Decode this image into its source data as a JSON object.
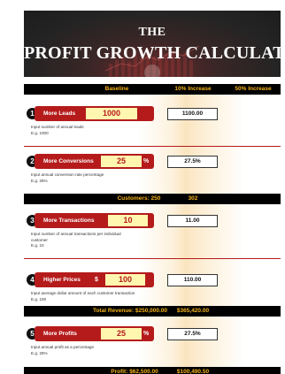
{
  "banner": {
    "title_small": "THE",
    "title_large": "PROFIT GROWTH CALCULATOR"
  },
  "header": {
    "baseline": "Baseline",
    "increase10": "10% Increase",
    "increase50": "50% Increase"
  },
  "steps": [
    {
      "number": "1",
      "label": "More Leads",
      "prefix": "",
      "value": "1000",
      "suffix": "",
      "help": [
        "Input number of annual leads",
        "E.g. 1000"
      ],
      "result": "1100.00"
    },
    {
      "number": "2",
      "label": "More Conversions",
      "prefix": "",
      "value": "25",
      "suffix": "%",
      "help": [
        "Input annual conversion rate percentage",
        "E.g. 25%"
      ],
      "result": "27.5%"
    },
    {
      "number": "3",
      "label": "More Transactions",
      "prefix": "",
      "value": "10",
      "suffix": "",
      "help": [
        "Input number of annual transactions per individual",
        "customer",
        "E.g. 10"
      ],
      "result": "11.00"
    },
    {
      "number": "4",
      "label": "Higher Prices",
      "prefix": "$",
      "value": "100",
      "suffix": "",
      "help": [
        "Input average dollar amount of each customer transaction",
        "E.g. 100"
      ],
      "result": "110.00"
    },
    {
      "number": "5",
      "label": "More Profits",
      "prefix": "",
      "value": "25",
      "suffix": "%",
      "help": [
        "Input annual profit as a percentage",
        "E.g. 25%"
      ],
      "result": "27.5%"
    }
  ],
  "summaries": {
    "customers": {
      "baseline": "Customers: 250",
      "increase10": "302"
    },
    "revenue": {
      "baseline": "Total Revenue: $250,000.00",
      "increase10": "$365,420.00"
    },
    "profit": {
      "baseline": "Profit: $62,500.00",
      "increase10": "$100,490.50"
    }
  },
  "colors": {
    "accent_red": "#b51b1b",
    "header_gold": "#f5b21a",
    "input_yellow": "#fff7b0"
  }
}
